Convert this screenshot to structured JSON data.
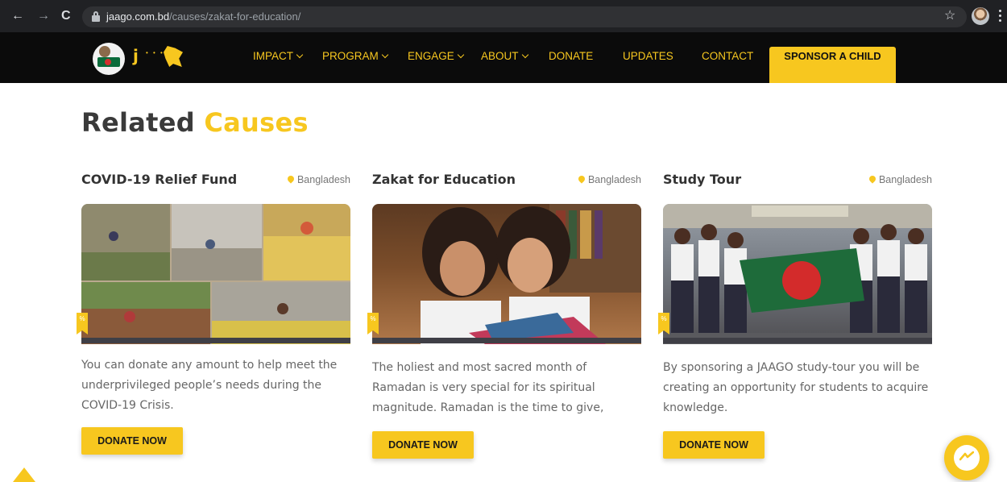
{
  "browser": {
    "url_domain": "jaago.com.bd",
    "url_path": "/causes/zakat-for-education/"
  },
  "nav": {
    "items": [
      {
        "label": "IMPACT",
        "dropdown": true
      },
      {
        "label": "PROGRAM",
        "dropdown": true
      },
      {
        "label": "ENGAGE",
        "dropdown": true
      },
      {
        "label": "ABOUT",
        "dropdown": true
      },
      {
        "label": "DONATE",
        "dropdown": false
      },
      {
        "label": "UPDATES",
        "dropdown": false
      },
      {
        "label": "CONTACT",
        "dropdown": false
      }
    ],
    "cta": "SPONSOR A CHILD"
  },
  "section": {
    "title_main": "Related",
    "title_accent": "Causes"
  },
  "causes": [
    {
      "title": "COVID-19 Relief Fund",
      "location": "Bangladesh",
      "badge": "%",
      "description": "You can donate any amount to help meet the underprivileged people’s needs during the COVID-19 Crisis.",
      "button": "DONATE NOW"
    },
    {
      "title": "Zakat for Education",
      "location": "Bangladesh",
      "badge": "%",
      "description": "The holiest and most sacred month of Ramadan is very special for its spiritual magnitude. Ramadan is the time to give,",
      "button": "DONATE NOW"
    },
    {
      "title": "Study Tour",
      "location": "Bangladesh",
      "badge": "%",
      "description": "By sponsoring a JAAGO study-tour you will be creating an opportunity for students to acquire knowledge.",
      "button": "DONATE NOW"
    }
  ],
  "colors": {
    "accent": "#f7c71f",
    "header_bg": "#0b0b0b",
    "text_dark": "#3a3a3a"
  }
}
